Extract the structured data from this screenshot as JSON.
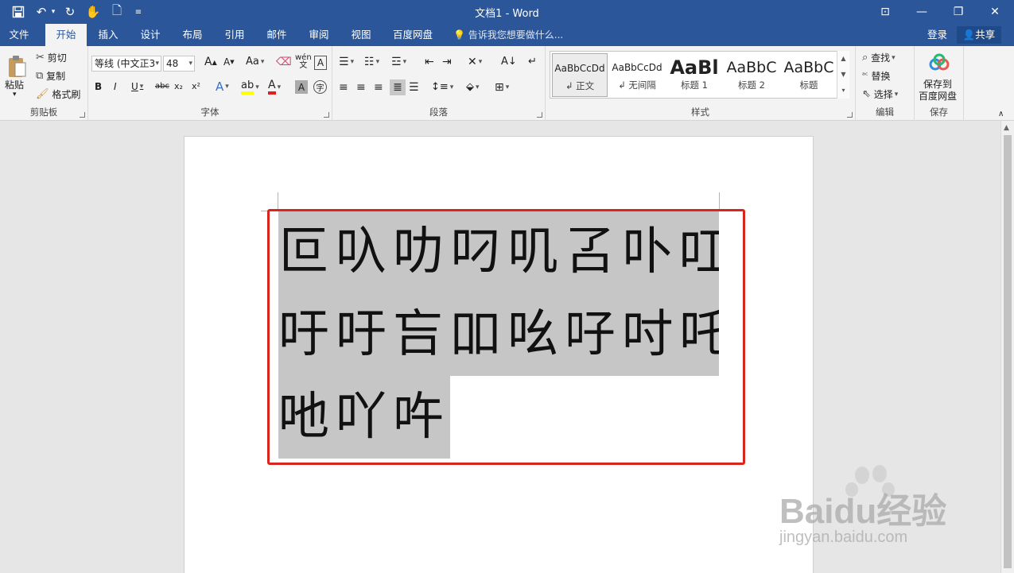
{
  "title_bar": {
    "title": "文档1 - Word",
    "quick_access": [
      "save-icon",
      "undo-icon",
      "redo-icon",
      "touch-mode-icon",
      "print-preview-icon",
      "customize-icon"
    ]
  },
  "tabs": [
    {
      "label": "文件",
      "active": false
    },
    {
      "label": "开始",
      "active": true
    },
    {
      "label": "插入",
      "active": false
    },
    {
      "label": "设计",
      "active": false
    },
    {
      "label": "布局",
      "active": false
    },
    {
      "label": "引用",
      "active": false
    },
    {
      "label": "邮件",
      "active": false
    },
    {
      "label": "审阅",
      "active": false
    },
    {
      "label": "视图",
      "active": false
    },
    {
      "label": "百度网盘",
      "active": false
    }
  ],
  "tell_me": "告诉我您想要做什么...",
  "account": {
    "login": "登录",
    "share": "共享"
  },
  "ribbon": {
    "clipboard": {
      "paste": "粘贴",
      "cut": "剪切",
      "copy": "复制",
      "format_painter": "格式刷",
      "label": "剪贴板"
    },
    "font": {
      "font_name": "等线 (中文正3",
      "font_size": "48",
      "label": "字体",
      "bold": "B",
      "italic": "I",
      "underline": "U",
      "strike": "abc",
      "sub": "x₂",
      "sup": "x²",
      "grow": "A",
      "shrink": "A",
      "case": "Aa"
    },
    "paragraph": {
      "label": "段落"
    },
    "styles": {
      "label": "样式",
      "items": [
        {
          "preview": "AaBbCcDd",
          "name": "↲ 正文",
          "selected": true
        },
        {
          "preview": "AaBbCcDd",
          "name": "↲ 无间隔",
          "selected": false
        },
        {
          "preview": "AaBl",
          "name": "标题 1",
          "selected": false
        },
        {
          "preview": "AaBbC",
          "name": "标题 2",
          "selected": false
        },
        {
          "preview": "AaBbC",
          "name": "标题",
          "selected": false
        }
      ]
    },
    "editing": {
      "find": "查找",
      "replace": "替换",
      "select": "选择",
      "label": "编辑"
    },
    "save": {
      "line1": "保存到",
      "line2": "百度网盘",
      "label": "保存"
    }
  },
  "document": {
    "lines": [
      "叵叺叻叼叽叾卟叿",
      "吁吁吂吅吆吇吋吒",
      "吔吖吘"
    ],
    "paragraph_mark": "↵"
  },
  "watermark": {
    "logo": "Baidu经验",
    "url": "jingyan.baidu.com"
  }
}
